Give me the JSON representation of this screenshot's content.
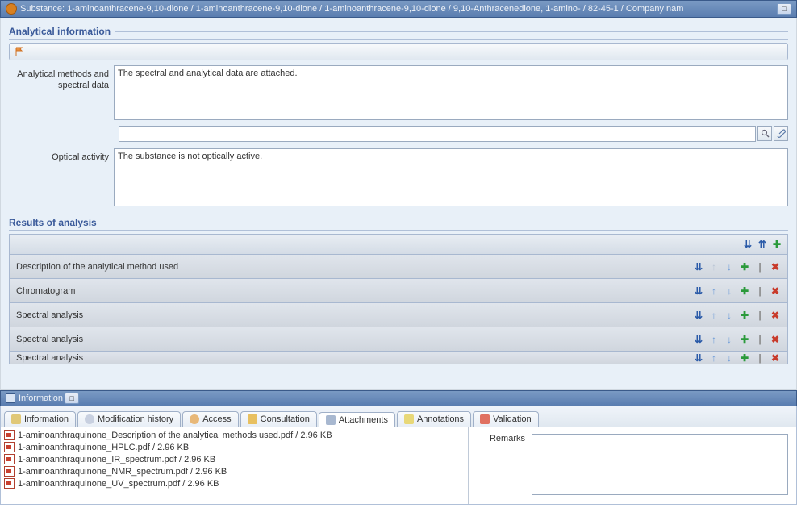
{
  "titlebar": {
    "title": "Substance: 1-aminoanthracene-9,10-dione / 1-aminoanthracene-9,10-dione / 1-aminoanthracene-9,10-dione / 9,10-Anthracenedione, 1-amino- / 82-45-1 / Company nam"
  },
  "analytical": {
    "heading": "Analytical information",
    "methods_label": "Analytical methods and spectral data",
    "methods_value": "The spectral and analytical data are attached.",
    "optical_label": "Optical activity",
    "optical_value": "The substance is not optically active."
  },
  "results": {
    "heading": "Results of analysis",
    "rows": [
      "Description of the analytical method used",
      "Chromatogram",
      "Spectral analysis",
      "Spectral analysis",
      "Spectral analysis"
    ]
  },
  "lower": {
    "title": "Information",
    "tabs": [
      "Information",
      "Modification history",
      "Access",
      "Consultation",
      "Attachments",
      "Annotations",
      "Validation"
    ],
    "remarks_label": "Remarks",
    "files": [
      {
        "name": "1-aminoanthraquinone_Description of the analytical methods used.pdf",
        "size": "2.96 KB"
      },
      {
        "name": "1-aminoanthraquinone_HPLC.pdf",
        "size": "2.96 KB"
      },
      {
        "name": "1-aminoanthraquinone_IR_spectrum.pdf",
        "size": "2.96 KB"
      },
      {
        "name": "1-aminoanthraquinone_NMR_spectrum.pdf",
        "size": "2.96 KB"
      },
      {
        "name": "1-aminoanthraquinone_UV_spectrum.pdf",
        "size": "2.96 KB"
      }
    ]
  }
}
